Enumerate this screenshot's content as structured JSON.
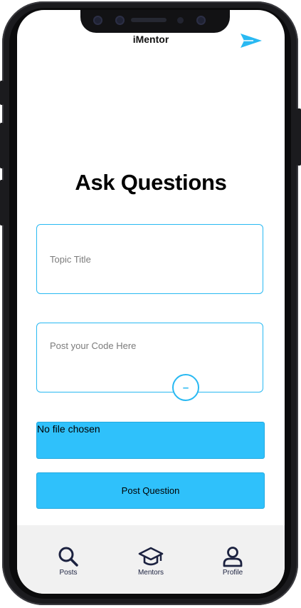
{
  "app": {
    "title": "iMentor"
  },
  "header": {
    "send_icon": "send-icon"
  },
  "page": {
    "title": "Ask Questions"
  },
  "form": {
    "topic_placeholder": "Topic Title",
    "code_placeholder": "Post your Code Here",
    "collapse_label": "–",
    "file_status": "No file chosen",
    "submit_label": "Post Question"
  },
  "tabs": [
    {
      "label": "Posts",
      "icon": "search-icon"
    },
    {
      "label": "Mentors",
      "icon": "graduation-cap-icon"
    },
    {
      "label": "Profile",
      "icon": "user-icon"
    }
  ],
  "colors": {
    "accent": "#2fc1fb",
    "border": "#29b9f2",
    "nav_icon": "#1c2240",
    "tabbar_bg": "#f1f1f1"
  }
}
